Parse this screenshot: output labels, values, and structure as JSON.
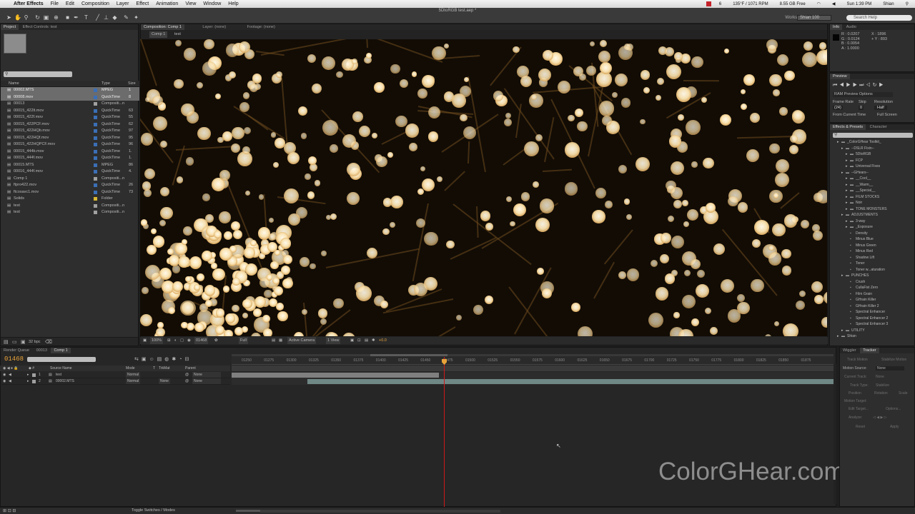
{
  "menubar": {
    "app": "After Effects",
    "items": [
      "File",
      "Edit",
      "Composition",
      "Layer",
      "Effect",
      "Animation",
      "View",
      "Window",
      "Help"
    ],
    "status": [
      "6",
      "135°F / 1071 RPM",
      "8.55 GB Free",
      "Sun 1:39 PM",
      "Shian"
    ]
  },
  "window_title": "5DtoRGB test.aep *",
  "workspace": {
    "label": "Workspace:",
    "value": "Shian 100"
  },
  "search_help": "Search Help",
  "project": {
    "tabs": [
      "Project",
      "Effect Controls: test"
    ],
    "columns": [
      "Name",
      "Type",
      "Size"
    ],
    "items": [
      {
        "name": "00002.MTS",
        "type": "MPEG",
        "size": "1",
        "color": "#3b6fb6",
        "selected": true
      },
      {
        "name": "00008.mov",
        "type": "QuickTime",
        "size": "8",
        "color": "#3b6fb6",
        "selected": true
      },
      {
        "name": "00013",
        "type": "Compositi...n",
        "size": "",
        "color": "#a0a0a0",
        "selected": false
      },
      {
        "name": "00015_422lt.mov",
        "type": "QuickTime",
        "size": "63",
        "color": "#3b6fb6",
        "selected": false
      },
      {
        "name": "00015_422f.mov",
        "type": "QuickTime",
        "size": "55",
        "color": "#3b6fb6",
        "selected": false
      },
      {
        "name": "00015_422PCF.mov",
        "type": "QuickTime",
        "size": "62",
        "color": "#3b6fb6",
        "selected": false
      },
      {
        "name": "00015_422HQb.mov",
        "type": "QuickTime",
        "size": "97",
        "color": "#3b6fb6",
        "selected": false
      },
      {
        "name": "00015_422HQf.mov",
        "type": "QuickTime",
        "size": "95",
        "color": "#3b6fb6",
        "selected": false
      },
      {
        "name": "00015_422HQPCF.mov",
        "type": "QuickTime",
        "size": "96",
        "color": "#3b6fb6",
        "selected": false
      },
      {
        "name": "00015_444b.mov",
        "type": "QuickTime",
        "size": "1.",
        "color": "#3b6fb6",
        "selected": false
      },
      {
        "name": "00015_444f.mov",
        "type": "QuickTime",
        "size": "1.",
        "color": "#3b6fb6",
        "selected": false
      },
      {
        "name": "00015.MTS",
        "type": "MPEG",
        "size": "86",
        "color": "#3b6fb6",
        "selected": false
      },
      {
        "name": "00016_444f.mov",
        "type": "QuickTime",
        "size": "4.",
        "color": "#3b6fb6",
        "selected": false
      },
      {
        "name": "Comp 1",
        "type": "Compositi...n",
        "size": "",
        "color": "#a0a0a0",
        "selected": false
      },
      {
        "name": "ftpro422.mov",
        "type": "QuickTime",
        "size": "26",
        "color": "#3b6fb6",
        "selected": false
      },
      {
        "name": "ftcosavc1.mov",
        "type": "QuickTime",
        "size": "73",
        "color": "#3b6fb6",
        "selected": false
      },
      {
        "name": "Solids",
        "type": "Folder",
        "size": "",
        "color": "#d9b832",
        "selected": false
      },
      {
        "name": "test",
        "type": "Compositi...n",
        "size": "",
        "color": "#a0a0a0",
        "selected": false
      },
      {
        "name": "test",
        "type": "Compositi...n",
        "size": "",
        "color": "#a0a0a0",
        "selected": false
      }
    ],
    "bpc": "32 bpc"
  },
  "comp": {
    "tabs": [
      "Composition: Comp 1",
      "Layer: (none)",
      "Footage: (none)"
    ],
    "subtabs": [
      "Comp 1",
      "test"
    ],
    "zoom": "100%",
    "timecode": "01468",
    "resolution": "Full",
    "camera": "Active Camera",
    "views": "1 View",
    "exposure": "+0.0"
  },
  "info": {
    "tabs": [
      "Info",
      "Audio"
    ],
    "r": "R : 0.0207",
    "g": "G : 0.0124",
    "b": "B : 0.0054",
    "a": "A : 1.0000",
    "x": "X : 1896",
    "y": "+ Y : 893"
  },
  "preview": {
    "title": "Preview",
    "ram": "RAM Preview Options",
    "frame_rate_label": "Frame Rate",
    "skip_label": "Skip",
    "resolution_label": "Resolution",
    "frame_rate": "(24)",
    "skip": "0",
    "resolution": "Half",
    "from_current": "From Current Time",
    "full_screen": "Full Screen"
  },
  "effects": {
    "tabs": [
      "Effects & Presets",
      "Character"
    ],
    "tree": [
      {
        "label": "_ColorGHear Toolkit_",
        "indent": 1,
        "type": "folder"
      },
      {
        "label": "--DSLR Fixin--",
        "indent": 2,
        "type": "folder"
      },
      {
        "label": "5DtoRGB",
        "indent": 3,
        "type": "folder"
      },
      {
        "label": "FCP",
        "indent": 3,
        "type": "folder"
      },
      {
        "label": "Universal Fixes",
        "indent": 3,
        "type": "folder"
      },
      {
        "label": "--GHears--",
        "indent": 2,
        "type": "folder"
      },
      {
        "label": "__Cool__",
        "indent": 3,
        "type": "folder"
      },
      {
        "label": "__Warm__",
        "indent": 3,
        "type": "folder"
      },
      {
        "label": "__Special__",
        "indent": 3,
        "type": "folder"
      },
      {
        "label": "FILM STOCKS",
        "indent": 3,
        "type": "folder"
      },
      {
        "label": "Noir",
        "indent": 3,
        "type": "folder"
      },
      {
        "label": "TONE MONSTERS",
        "indent": 3,
        "type": "folder"
      },
      {
        "label": "ADJUSTMENTS",
        "indent": 2,
        "type": "folder"
      },
      {
        "label": "3-way",
        "indent": 3,
        "type": "folder"
      },
      {
        "label": "_Exposure",
        "indent": 3,
        "type": "folder"
      },
      {
        "label": "Density",
        "indent": 3,
        "type": "preset"
      },
      {
        "label": "Minus Blue",
        "indent": 3,
        "type": "preset"
      },
      {
        "label": "Minus Green",
        "indent": 3,
        "type": "preset"
      },
      {
        "label": "Minus Red",
        "indent": 3,
        "type": "preset"
      },
      {
        "label": "Shadow Lift",
        "indent": 3,
        "type": "preset"
      },
      {
        "label": "Toner",
        "indent": 3,
        "type": "preset"
      },
      {
        "label": "Toner w...aturation",
        "indent": 3,
        "type": "preset"
      },
      {
        "label": "PUNCHES",
        "indent": 2,
        "type": "folder"
      },
      {
        "label": "Crush",
        "indent": 3,
        "type": "preset"
      },
      {
        "label": "CullaFist Zero",
        "indent": 3,
        "type": "preset"
      },
      {
        "label": "Film Grain",
        "indent": 3,
        "type": "preset"
      },
      {
        "label": "GHrain Killer",
        "indent": 3,
        "type": "preset"
      },
      {
        "label": "GHrain Killer 2",
        "indent": 3,
        "type": "preset"
      },
      {
        "label": "Spectral Enhancer",
        "indent": 3,
        "type": "preset"
      },
      {
        "label": "Spectral Enhancer 2",
        "indent": 3,
        "type": "preset"
      },
      {
        "label": "Spectral Enhancer 3",
        "indent": 3,
        "type": "preset"
      },
      {
        "label": "UTILITY",
        "indent": 2,
        "type": "folder"
      },
      {
        "label": "Shian",
        "indent": 1,
        "type": "folder"
      }
    ]
  },
  "timeline": {
    "tabs": [
      "Render Queue",
      "00013",
      "Comp 1"
    ],
    "timecode": "01468",
    "columns": [
      "Source Name",
      "Mode",
      "T",
      "TrkMat",
      "Parent"
    ],
    "layers": [
      {
        "num": "1",
        "name": "test",
        "mode": "Normal",
        "trkmat": "",
        "parent": "None"
      },
      {
        "num": "2",
        "name": "00002.MTS",
        "mode": "Normal",
        "trkmat": "None",
        "parent": "None"
      }
    ],
    "ruler": [
      "01250",
      "01275",
      "01300",
      "01325",
      "01350",
      "01375",
      "01400",
      "01425",
      "01450",
      "01475",
      "01500",
      "01525",
      "01550",
      "01575",
      "01600",
      "01625",
      "01650",
      "01675",
      "01700",
      "01725",
      "01750",
      "01775",
      "01800",
      "01825",
      "01850",
      "01875"
    ],
    "toggle": "Toggle Switches / Modes"
  },
  "tracker": {
    "tabs": [
      "Wiggler",
      "Tracker"
    ],
    "buttons": [
      "Track Motion",
      "Stabilize Motion"
    ],
    "motion_source_label": "Motion Source:",
    "motion_source": "None",
    "current_track_label": "Current Track:",
    "current_track": "None",
    "track_type_label": "Track Type:",
    "track_type": "Stabilize",
    "position": "Position",
    "rotation": "Rotation",
    "scale": "Scale",
    "motion_target": "Motion Target:",
    "edit_target": "Edit Target...",
    "options": "Options...",
    "analyze": "Analyze:",
    "reset": "Reset",
    "apply": "Apply"
  },
  "watermark": "ColorGHear.com",
  "colors": {
    "timecode": "#e8a33a",
    "playhead": "#d01818",
    "bar_orange": "#e8a33a"
  }
}
